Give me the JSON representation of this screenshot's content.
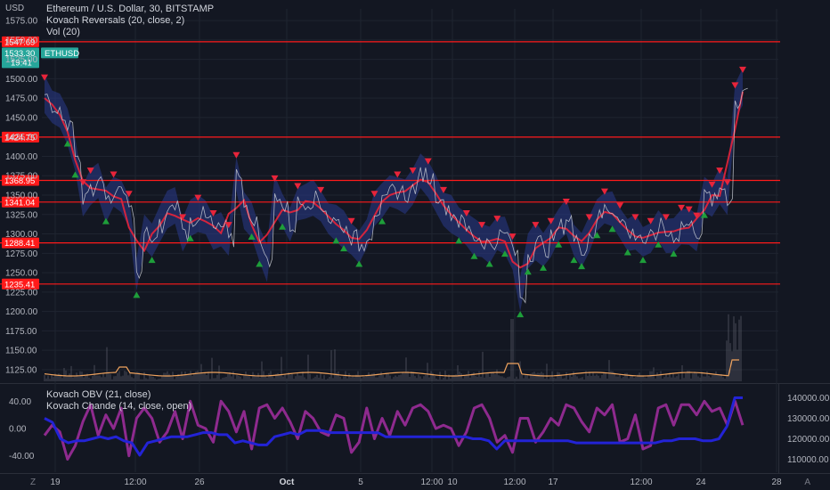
{
  "header": {
    "unit": "USD",
    "title": "Ethereum / U.S. Dollar, 30, BITSTAMP",
    "indicator_1": "Kovach Reversals (20, close, 2)",
    "indicator_2": "Vol (20)"
  },
  "subpane": {
    "indicator_1": "Kovach OBV (21, close)",
    "indicator_2": "Kovach Chande (14, close, open)"
  },
  "footer": {
    "left_button": "Z",
    "right_button": "A"
  },
  "colors": {
    "background": "#131722",
    "grid": "#1f2430",
    "text": "#b2b5be",
    "level_line": "#ff1a1a",
    "price_line": "#c8cbd2",
    "band_outer": "#2a3a8c",
    "ma_line": "#e8243a",
    "arrow_down": "#e8243a",
    "arrow_up": "#1e9e3a",
    "ticker_badge": "#26a69a",
    "volume": "#5d606b",
    "volume_ma": "#f0a35e",
    "chande": "#8e2a8e",
    "obv": "#2323d6"
  },
  "chart_data": [
    {
      "type": "line",
      "title": "Ethereum / U.S. Dollar, 30, BITSTAMP",
      "ylabel": "USD",
      "ylim": [
        1110,
        1590
      ],
      "y_ticks": [
        1125.0,
        1150.0,
        1175.0,
        1200.0,
        1225.0,
        1250.0,
        1275.0,
        1300.0,
        1325.0,
        1350.0,
        1375.0,
        1400.0,
        1425.0,
        1450.0,
        1475.0,
        1500.0,
        1525.0,
        1550.0,
        1575.0
      ],
      "x_ticks": [
        "19",
        "12:00",
        "26",
        "Oct",
        "5",
        "12:00",
        "10",
        "12:00",
        "17",
        "12:00",
        "24",
        "28"
      ],
      "level_lines": [
        {
          "label": "1547.69",
          "value": 1547.69
        },
        {
          "label": "1424.75",
          "value": 1424.75
        },
        {
          "label": "1368.95",
          "value": 1368.95
        },
        {
          "label": "1341.04",
          "value": 1341.04
        },
        {
          "label": "1288.41",
          "value": 1288.41
        },
        {
          "label": "1235.41",
          "value": 1235.41
        }
      ],
      "last_price": {
        "label": "1533.30",
        "countdown": "19:41",
        "ticker": "ETHUSD"
      },
      "series": [
        {
          "name": "ETHUSD close",
          "values": [
            1480,
            1465,
            1455,
            1440,
            1400,
            1345,
            1360,
            1372,
            1340,
            1355,
            1350,
            1330,
            1245,
            1300,
            1290,
            1310,
            1332,
            1338,
            1300,
            1318,
            1325,
            1318,
            1305,
            1308,
            1290,
            1380,
            1330,
            1320,
            1285,
            1262,
            1350,
            1333,
            1310,
            1340,
            1342,
            1345,
            1335,
            1318,
            1315,
            1305,
            1295,
            1285,
            1300,
            1330,
            1340,
            1355,
            1355,
            1350,
            1360,
            1378,
            1372,
            1350,
            1335,
            1325,
            1315,
            1305,
            1295,
            1290,
            1285,
            1298,
            1298,
            1275,
            1220,
            1275,
            1290,
            1280,
            1295,
            1310,
            1320,
            1290,
            1282,
            1300,
            1322,
            1333,
            1330,
            1315,
            1300,
            1300,
            1290,
            1295,
            1310,
            1300,
            1298,
            1312,
            1310,
            1302,
            1348,
            1342,
            1360,
            1345,
            1470,
            1490
          ]
        }
      ],
      "signals_down": 40,
      "signals_up": 30
    },
    {
      "type": "bar",
      "title": "Vol (20)",
      "note": "volume histogram with moving average overlay"
    },
    {
      "type": "line",
      "title": "Kovach OBV (21, close) / Kovach Chande (14, close, open)",
      "left_ylim": [
        -60,
        60
      ],
      "left_ticks": [
        40.0,
        0.0,
        -40.0
      ],
      "right_ylim": [
        105000,
        145000
      ],
      "right_ticks": [
        140000.0,
        130000.0,
        120000.0,
        110000.0
      ],
      "series": [
        {
          "name": "Kovach Chande (14, close, open)",
          "values": [
            -10,
            5,
            -5,
            -45,
            -25,
            10,
            35,
            -10,
            20,
            0,
            30,
            -40,
            15,
            30,
            15,
            -20,
            -5,
            25,
            -15,
            40,
            5,
            0,
            -20,
            40,
            25,
            -5,
            25,
            -30,
            30,
            35,
            15,
            30,
            10,
            -15,
            25,
            15,
            -5,
            -10,
            20,
            15,
            -35,
            -20,
            30,
            -15,
            15,
            -10,
            25,
            5,
            30,
            35,
            25,
            0,
            5,
            0,
            -25,
            -5,
            30,
            35,
            15,
            -20,
            -10,
            -35,
            15,
            15,
            -20,
            -5,
            15,
            5,
            35,
            30,
            10,
            -5,
            30,
            20,
            35,
            -20,
            -15,
            20,
            -30,
            -25,
            30,
            35,
            5,
            35,
            35,
            20,
            40,
            25,
            30,
            5,
            40,
            5
          ]
        },
        {
          "name": "Kovach OBV (21, close)",
          "values": [
            130000,
            128000,
            120000,
            118000,
            119000,
            119000,
            120000,
            121000,
            120000,
            121000,
            119000,
            118000,
            112000,
            118000,
            119000,
            120000,
            121000,
            121000,
            121000,
            122000,
            123000,
            123000,
            122000,
            122000,
            118000,
            119000,
            118000,
            117000,
            117000,
            121000,
            122000,
            123000,
            122000,
            124000,
            124000,
            124000,
            123000,
            123000,
            123000,
            123000,
            123000,
            123000,
            123000,
            121000,
            121000,
            121000,
            121000,
            121000,
            121000,
            121000,
            121000,
            121000,
            121000,
            121000,
            120000,
            120000,
            119000,
            115000,
            119000,
            119000,
            119000,
            119000,
            119000,
            119000,
            119000,
            119000,
            119000,
            118000,
            118000,
            118000,
            118000,
            118000,
            118000,
            118000,
            118000,
            118000,
            118000,
            118000,
            119000,
            119000,
            120000,
            120000,
            120000,
            119000,
            119000,
            120000,
            126000,
            140000,
            140000
          ]
        }
      ]
    }
  ]
}
